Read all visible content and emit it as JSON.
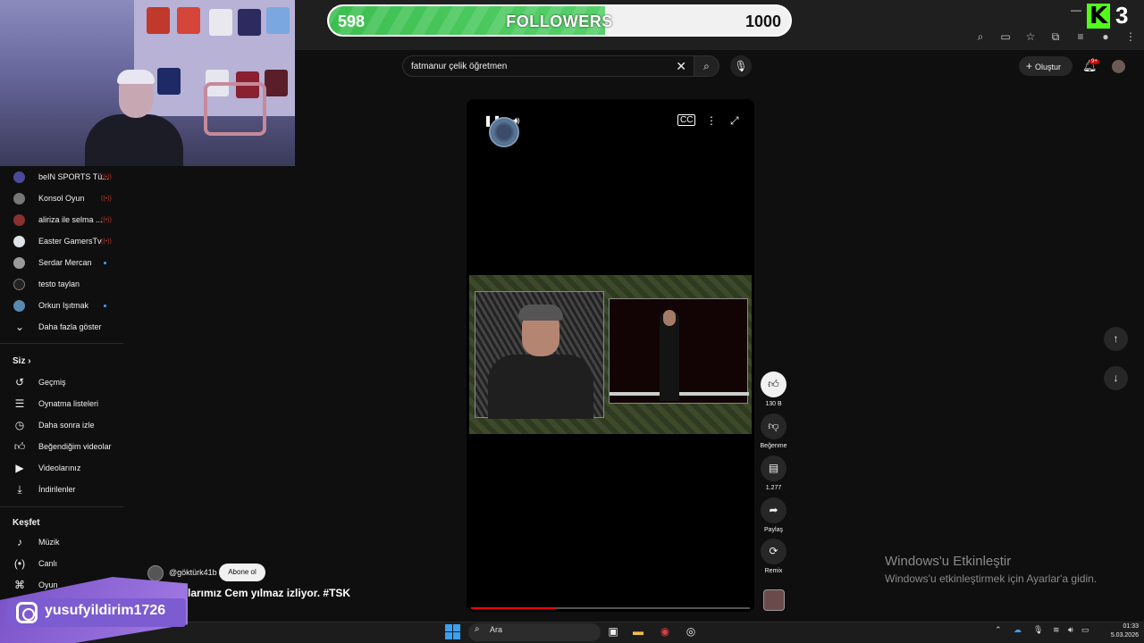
{
  "followers": {
    "current": "598",
    "label": "FOLLOWERS",
    "goal": "1000",
    "progress": 0.598,
    "color": "#4cc95f"
  },
  "kick": {
    "count": "3",
    "color": "#53fc18"
  },
  "search": {
    "query": "fatmanur çelik öğretmen"
  },
  "header": {
    "create_label": "Oluştur",
    "notif_badge": "9+"
  },
  "sidebar": {
    "subscriptions": [
      {
        "label": "beIN SPORTS Tü...",
        "indicator": "live"
      },
      {
        "label": "Konsol Oyun",
        "indicator": "live"
      },
      {
        "label": "aliriza ile selma ...",
        "indicator": "live"
      },
      {
        "label": "Easter GamersTv",
        "indicator": "live"
      },
      {
        "label": "Serdar Mercan",
        "indicator": "dot"
      },
      {
        "label": "testo taylan",
        "indicator": "none"
      },
      {
        "label": "Orkun Işıtmak",
        "indicator": "dot"
      }
    ],
    "show_more": "Daha fazla göster",
    "you_header": "Siz",
    "you_items": [
      {
        "label": "Geçmiş",
        "icon": "history-icon"
      },
      {
        "label": "Oynatma listeleri",
        "icon": "playlist-icon"
      },
      {
        "label": "Daha sonra izle",
        "icon": "watch-later-icon"
      },
      {
        "label": "Beğendiğim videolar",
        "icon": "like-icon"
      },
      {
        "label": "Videolarınız",
        "icon": "video-icon"
      },
      {
        "label": "İndirilenler",
        "icon": "download-icon"
      }
    ],
    "explore_header": "Keşfet",
    "explore_items": [
      {
        "label": "Müzik",
        "icon": "music-icon"
      },
      {
        "label": "Canlı",
        "icon": "live-icon"
      },
      {
        "label": "Oyun",
        "icon": "gaming-icon"
      }
    ]
  },
  "short": {
    "channel": "@göktürk41b",
    "subscribe_label": "Abone ol",
    "title": "anlarımız Cem yılmaz izliyor. #TSK",
    "progress": 0.3,
    "actions": {
      "likes": "130 B",
      "dislike_label": "Beğenme",
      "comments": "1.277",
      "share_label": "Paylaş",
      "remix_label": "Remix"
    }
  },
  "windows_activation": {
    "title": "Windows'u Etkinleştir",
    "subtitle": "Windows'u etkinleştirmek için Ayarlar'a gidin."
  },
  "instagram": {
    "handle": "yusufyildirim1726"
  },
  "taskbar": {
    "search_placeholder": "Ara",
    "time": "01:33",
    "date": "5.03.2026"
  }
}
